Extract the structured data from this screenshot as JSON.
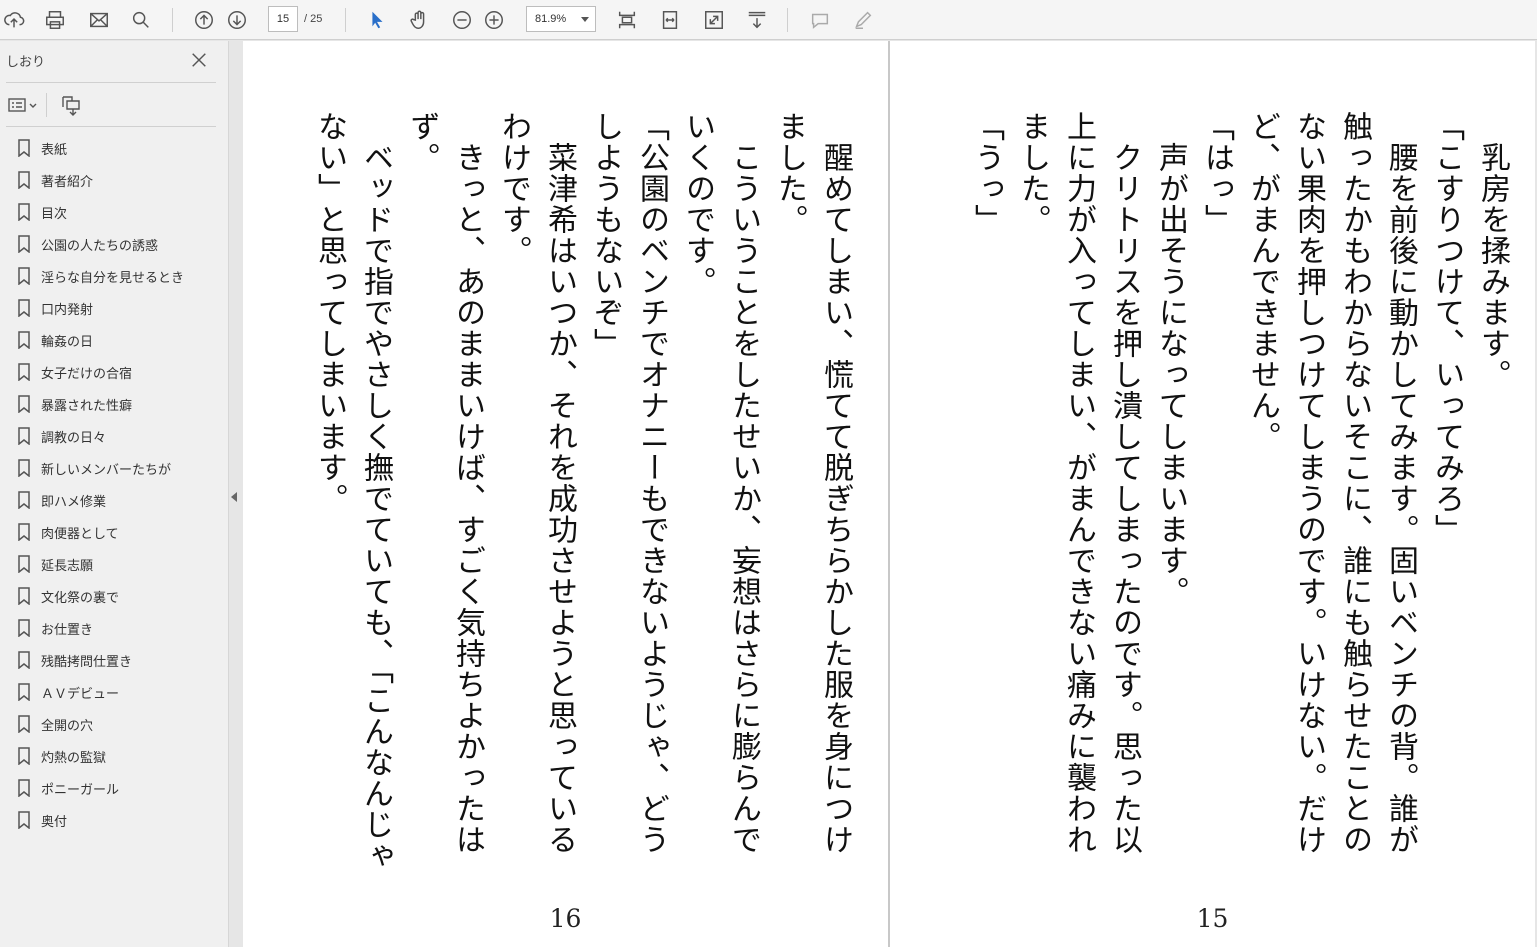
{
  "toolbar": {
    "page_current": "15",
    "page_total": "/ 25",
    "zoom": "81.9%"
  },
  "sidebar": {
    "title": "しおり",
    "bookmarks": [
      "表紙",
      "著者紹介",
      "目次",
      "公園の人たちの誘惑",
      "淫らな自分を見せるとき",
      "口内発射",
      "輪姦の日",
      "女子だけの合宿",
      "暴露された性癖",
      "調教の日々",
      "新しいメンバーたちが",
      "即ハメ修業",
      "肉便器として",
      "延長志願",
      "文化祭の裏で",
      "お仕置き",
      "残酷拷問仕置き",
      "ＡＶデビュー",
      "全開の穴",
      "灼熱の監獄",
      "ポニーガール",
      "奥付"
    ]
  },
  "left_page": {
    "number": "16",
    "lines": [
      "　醒めてしまい、慌てて脱ぎちらかした服を身につけ",
      "ました。",
      "　こういうことをしたせいか、妄想はさらに膨らんで",
      "いくのです。",
      "「公園のベンチでオナニーもできないようじゃ、どう",
      "しようもないぞ」",
      "　菜津希はいつか、それを成功させようと思っている",
      "わけです。",
      "　きっと、あのままいけば、すごく気持ちよかったは",
      "ず。",
      "　ベッドで指でやさしく撫でていても、「こんなんじゃ",
      "ない」と思ってしまいます。"
    ]
  },
  "right_page": {
    "number": "15",
    "lines": [
      "　乳房を揉みます。",
      "「こすりつけて、いってみろ」",
      "　腰を前後に動かしてみます。固いベンチの背。誰が",
      "触ったかもわからないそこに、誰にも触らせたことの",
      "ない果肉を押しつけてしまうのです。いけない。だけ",
      "ど、がまんできません。",
      "「はっ」",
      "　声が出そうになってしまいます。",
      "　クリトリスを押し潰してしまったのです。思った以",
      "上に力が入ってしまい、がまんできない痛みに襲われ",
      "ました。",
      "「うっ」"
    ]
  }
}
